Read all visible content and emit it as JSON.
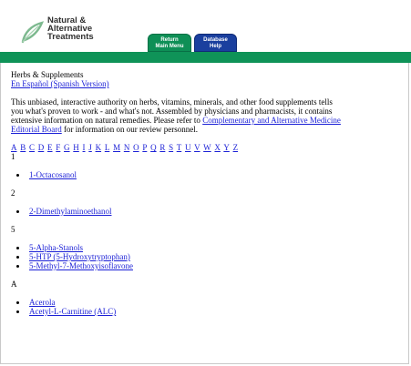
{
  "header": {
    "logo_lines": [
      "Natural &",
      "Alternative",
      "Treatments"
    ],
    "tabs": {
      "return": [
        "Return",
        "Main Menu"
      ],
      "help": [
        "Database",
        "Help"
      ]
    }
  },
  "intro": {
    "title": "Herbs & Supplements",
    "spanish_link": "En Español (Spanish Version)",
    "desc1": "This unbiased, interactive authority on herbs, vitamins, minerals, and other food supplements tells",
    "desc2": "you what's proven to work - and what's not. Assembled by physicians and pharmacists, it contains",
    "desc3": "extensive information on natural remedies. Please refer to ",
    "board_link_1": "Complementary and Alternative Medicine",
    "board_link_2": "Editorial Board",
    "desc_tail": " for information on our review personnel."
  },
  "alphabet": [
    "A",
    "B",
    "C",
    "D",
    "E",
    "F",
    "G",
    "H",
    "I",
    "J",
    "K",
    "L",
    "M",
    "N",
    "O",
    "P",
    "Q",
    "R",
    "S",
    "T",
    "U",
    "V",
    "W",
    "X",
    "Y",
    "Z"
  ],
  "sections": [
    {
      "heading": "1",
      "items": [
        "1-Octacosanol"
      ]
    },
    {
      "heading": "2",
      "items": [
        "2-Dimethylaminoethanol"
      ]
    },
    {
      "heading": "5",
      "items": [
        "5-Alpha-Stanols",
        "5-HTP (5-Hydroxytryptophan)",
        "5-Methyl-7-Methoxyisoflavone"
      ]
    },
    {
      "heading": "A",
      "items": [
        "Acerola",
        "Acetyl-L-Carnitine (ALC)"
      ]
    }
  ]
}
